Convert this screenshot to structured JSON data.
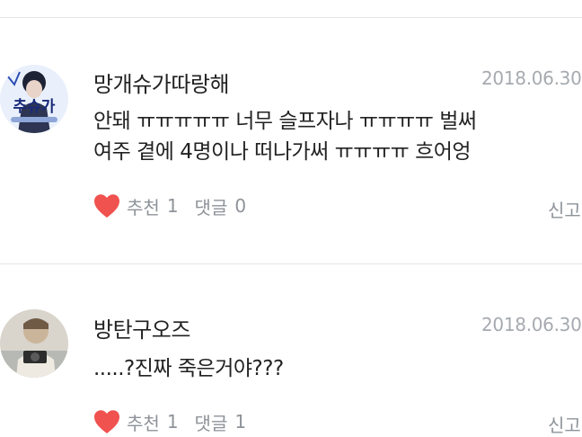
{
  "comments": [
    {
      "author": "망개슈가따랑해",
      "date": "2018.06.30",
      "avatar_text": "추슈가",
      "body_lines": [
        "안돼 ㅠㅠㅠㅠㅠ 너무 슬프자나 ㅠㅠㅠㅠ 벌써",
        "여주 곁에 4명이나 떠나가써 ㅠㅠㅠㅠ 흐어엉"
      ],
      "like_label": "추천",
      "like_count": "1",
      "reply_label": "댓글",
      "reply_count": "0",
      "report_label": "신고"
    },
    {
      "author": "방탄구오즈",
      "date": "2018.06.30",
      "body_lines": [
        ".....?진짜 죽은거야???"
      ],
      "like_label": "추천",
      "like_count": "1",
      "reply_label": "댓글",
      "reply_count": "1",
      "report_label": "신고"
    }
  ],
  "colors": {
    "heart": "#f0524f",
    "meta_text": "#8e9399",
    "date_text": "#a6aab0",
    "divider": "#e4e6e9"
  },
  "icons": {
    "like": "heart-icon"
  }
}
